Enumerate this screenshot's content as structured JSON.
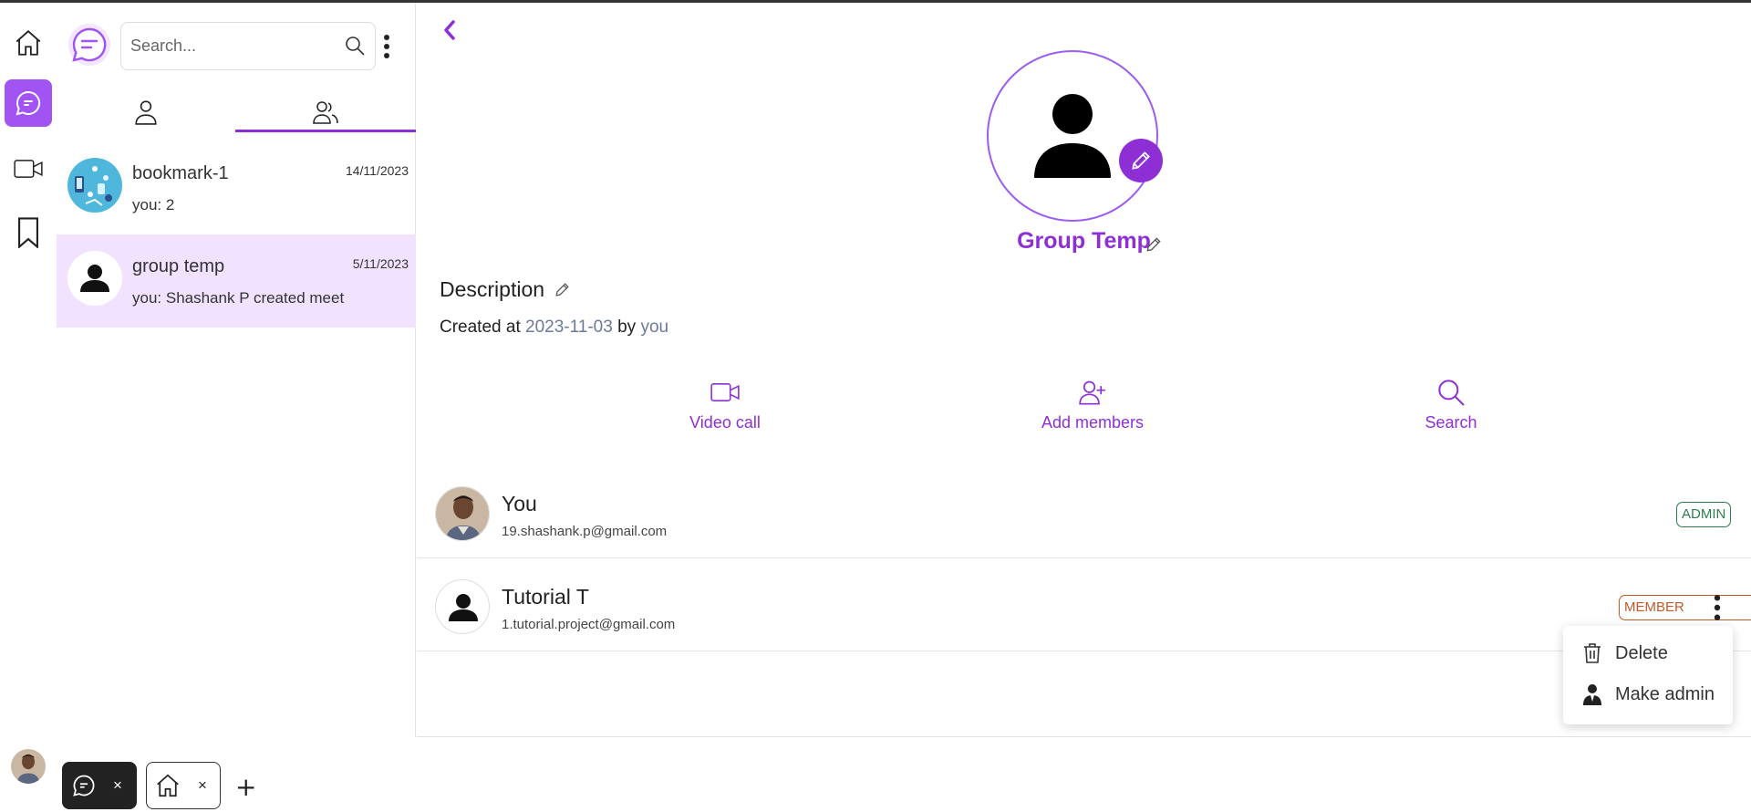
{
  "rail": {
    "items": [
      {
        "icon": "home-icon",
        "active": false
      },
      {
        "icon": "chat-icon",
        "active": true
      },
      {
        "icon": "video-camera-icon",
        "active": false
      },
      {
        "icon": "bookmark-icon",
        "active": false
      }
    ]
  },
  "sidebar": {
    "search": {
      "placeholder": "Search...",
      "value": ""
    },
    "tabs": [
      {
        "icon": "person-icon",
        "active": false
      },
      {
        "icon": "group-icon",
        "active": true
      }
    ],
    "conversations": [
      {
        "name": "bookmark-1",
        "preview": "you: 2",
        "date": "14/11/2023",
        "selected": false
      },
      {
        "name": "group temp",
        "preview": "you: Shashank P created meet",
        "date": "5/11/2023",
        "selected": true
      }
    ]
  },
  "group": {
    "name": "Group Temp",
    "description_label": "Description",
    "created_prefix": "Created at",
    "created_date": "2023-11-03",
    "created_by_word": "by",
    "created_by": "you"
  },
  "actions": [
    {
      "label": "Video call",
      "icon": "video-camera-icon"
    },
    {
      "label": "Add members",
      "icon": "add-user-icon"
    },
    {
      "label": "Search",
      "icon": "search-icon"
    }
  ],
  "members": [
    {
      "name": "You",
      "email": "19.shashank.p@gmail.com",
      "role": "ADMIN",
      "has_menu": false
    },
    {
      "name": "Tutorial T",
      "email": "1.tutorial.project@gmail.com",
      "role": "MEMBER",
      "has_menu": true
    }
  ],
  "member_menu": {
    "items": [
      {
        "label": "Delete",
        "icon": "trash-icon"
      },
      {
        "label": "Make admin",
        "icon": "admin-user-icon"
      }
    ]
  },
  "bottom_tabs": [
    {
      "icon": "chat-icon",
      "close": "×",
      "active": true
    },
    {
      "icon": "home-icon",
      "close": "×",
      "active": false
    }
  ],
  "bottom_add": "+",
  "colors": {
    "accent": "#8e2fd6",
    "accent_light": "#a154f2",
    "selected_row": "#f1e3ff",
    "admin_badge": "#2e7d4f",
    "member_badge": "#c05a2a"
  }
}
